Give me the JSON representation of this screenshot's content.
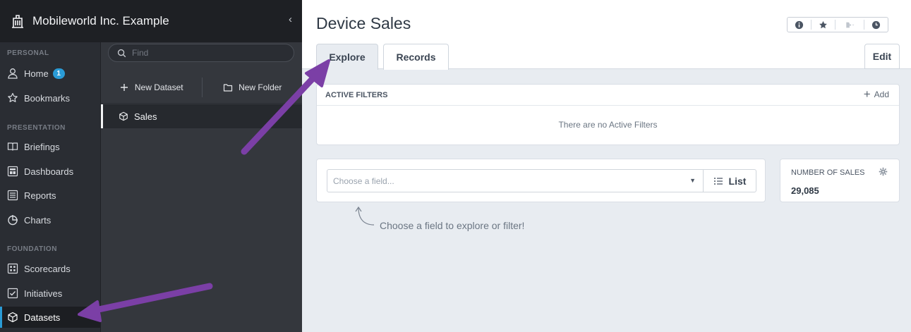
{
  "org": {
    "name": "Mobileworld Inc. Example"
  },
  "sidebar": {
    "sections": [
      "PERSONAL",
      "PRESENTATION",
      "FOUNDATION"
    ],
    "items": [
      {
        "label": "Home",
        "icon": "user-icon",
        "badge": "1"
      },
      {
        "label": "Bookmarks",
        "icon": "star-icon"
      },
      {
        "label": "Briefings",
        "icon": "book-icon"
      },
      {
        "label": "Dashboards",
        "icon": "dashboard-icon"
      },
      {
        "label": "Reports",
        "icon": "report-icon"
      },
      {
        "label": "Charts",
        "icon": "pie-chart-icon"
      },
      {
        "label": "Scorecards",
        "icon": "scorecard-icon"
      },
      {
        "label": "Initiatives",
        "icon": "checkbox-icon"
      },
      {
        "label": "Datasets",
        "icon": "cube-icon",
        "active": true
      }
    ]
  },
  "middle": {
    "search_placeholder": "Find",
    "new_dataset_label": "New Dataset",
    "new_folder_label": "New Folder",
    "datasets": [
      {
        "label": "Sales"
      }
    ]
  },
  "main": {
    "title": "Device Sales",
    "tabs": [
      {
        "label": "Explore",
        "active": true
      },
      {
        "label": "Records"
      }
    ],
    "edit_label": "Edit",
    "filters": {
      "heading": "ACTIVE FILTERS",
      "add_label": "Add",
      "empty_message": "There are no Active Filters"
    },
    "explore": {
      "field_placeholder": "Choose a field...",
      "list_label": "List",
      "hint": "Choose a field to explore or filter!"
    },
    "metric": {
      "label": "NUMBER OF SALES",
      "value": "29,085"
    }
  },
  "colors": {
    "accent": "#2a9bd6",
    "annotation_arrow": "#7b3fa6",
    "sidebar_bg": "#2a2d33"
  }
}
